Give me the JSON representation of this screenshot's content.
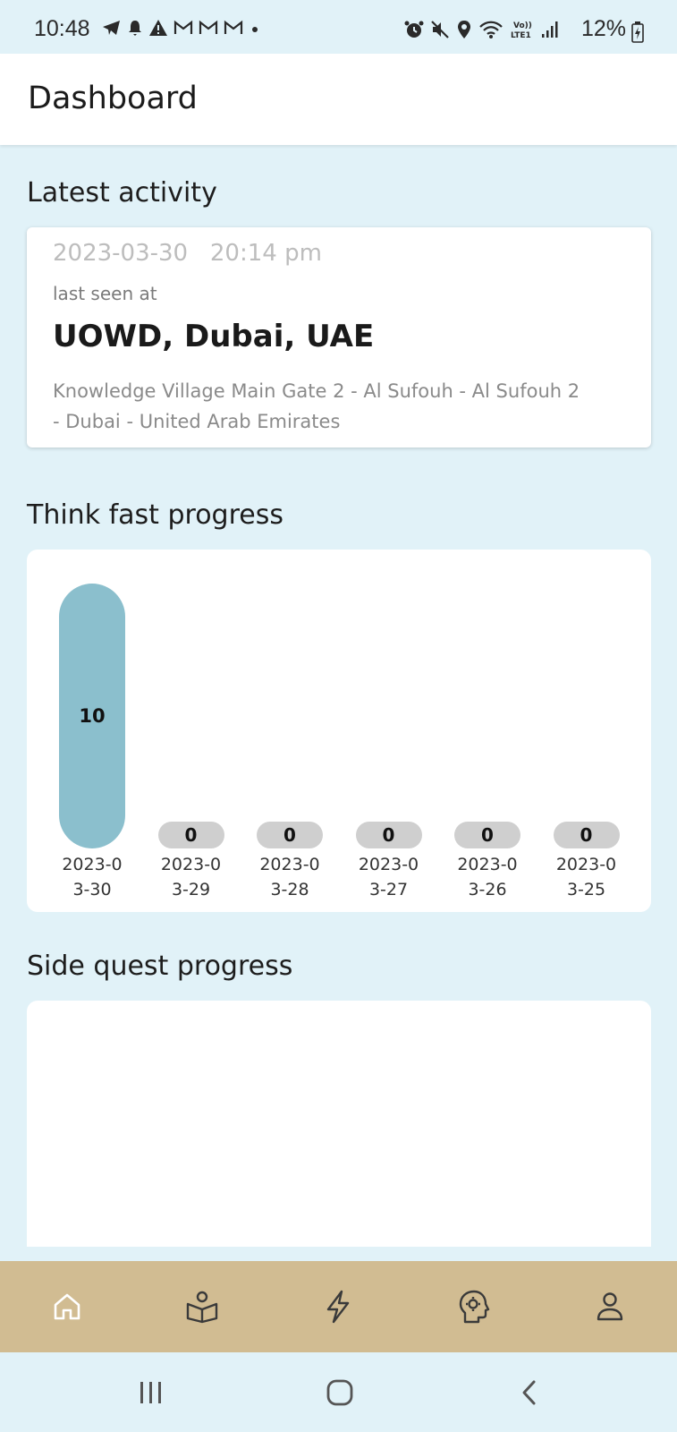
{
  "status_bar": {
    "time": "10:48",
    "battery": "12%",
    "left_icons": [
      "telegram-icon",
      "bell-icon",
      "warning-icon",
      "gmail-icon",
      "gmail-icon",
      "gmail-icon",
      "dot-icon"
    ],
    "right_icons": [
      "alarm-icon",
      "mute-icon",
      "location-icon",
      "wifi-icon",
      "volte-icon",
      "signal-icon"
    ]
  },
  "app_bar": {
    "title": "Dashboard"
  },
  "latest_activity": {
    "heading": "Latest activity",
    "datetime": "2023-03-30   20:14 pm",
    "label": "last seen at",
    "place": "UOWD, Dubai, UAE",
    "address": "Knowledge Village Main Gate 2 - Al Sufouh - Al Sufouh 2 - Dubai - United Arab Emirates"
  },
  "think_fast": {
    "heading": "Think fast progress"
  },
  "side_quest": {
    "heading": "Side quest progress"
  },
  "chart_data": {
    "type": "bar",
    "categories": [
      "2023-03-30",
      "2023-03-29",
      "2023-03-28",
      "2023-03-27",
      "2023-03-26",
      "2023-03-25"
    ],
    "category_labels": [
      "2023-0\n3-30",
      "2023-0\n3-29",
      "2023-0\n3-28",
      "2023-0\n3-27",
      "2023-0\n3-26",
      "2023-0\n3-25"
    ],
    "values": [
      10,
      0,
      0,
      0,
      0,
      0
    ],
    "data_labels": [
      "10",
      "0",
      "0",
      "0",
      "0",
      "0"
    ],
    "colors": {
      "positive": "#8bbfcd",
      "zero": "#cfcfcf"
    }
  },
  "bottom_nav": {
    "background": "#d1bc92",
    "items": [
      {
        "icon": "home-icon",
        "active": true
      },
      {
        "icon": "book-reader-icon",
        "active": false
      },
      {
        "icon": "lightning-icon",
        "active": false
      },
      {
        "icon": "head-gear-icon",
        "active": false
      },
      {
        "icon": "profile-icon",
        "active": false
      }
    ]
  },
  "system_nav": {
    "items": [
      "recents-icon",
      "home-circle-icon",
      "back-icon"
    ]
  }
}
